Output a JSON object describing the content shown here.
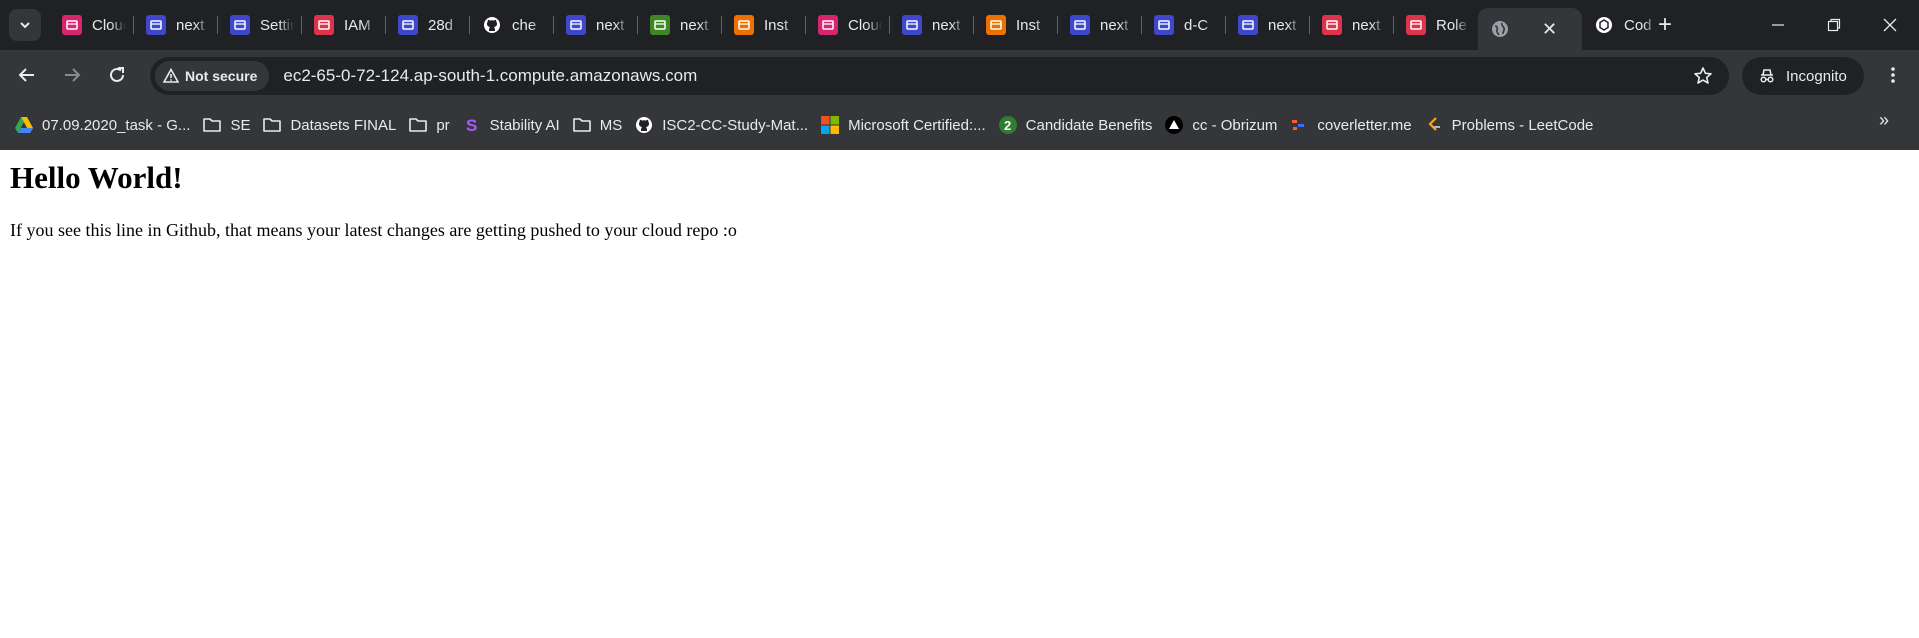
{
  "browser": {
    "tabs": [
      {
        "label": "Cloud",
        "icon": "aws-cloudshell-icon",
        "color": "#d6246e"
      },
      {
        "label": "next",
        "icon": "aws-s3-bucket-icon",
        "color": "#3f48cc"
      },
      {
        "label": "Settings",
        "icon": "aws-s3-bucket-icon",
        "color": "#3f48cc"
      },
      {
        "label": "IAM",
        "icon": "aws-iam-icon",
        "color": "#dd344c"
      },
      {
        "label": "28d",
        "icon": "aws-s3-bucket-icon",
        "color": "#3f48cc"
      },
      {
        "label": "che",
        "icon": "github-icon",
        "color": "#ffffff"
      },
      {
        "label": "next",
        "icon": "aws-service-icon",
        "color": "#3f48cc"
      },
      {
        "label": "next",
        "icon": "aws-codecommit-icon",
        "color": "#3f8624"
      },
      {
        "label": "Inst",
        "icon": "aws-ec2-icon",
        "color": "#ed7100"
      },
      {
        "label": "Cloud",
        "icon": "aws-cloudshell-icon",
        "color": "#d6246e"
      },
      {
        "label": "next",
        "icon": "aws-s3-bucket-icon",
        "color": "#3f48cc"
      },
      {
        "label": "Inst",
        "icon": "aws-ec2-icon",
        "color": "#ed7100"
      },
      {
        "label": "next",
        "icon": "aws-s3-bucket-icon",
        "color": "#3f48cc"
      },
      {
        "label": "d-C",
        "icon": "aws-service-icon",
        "color": "#3f48cc"
      },
      {
        "label": "next",
        "icon": "aws-service-icon",
        "color": "#3f48cc"
      },
      {
        "label": "next",
        "icon": "aws-iam-icon",
        "color": "#dd344c"
      },
      {
        "label": "Role",
        "icon": "aws-iam-icon",
        "color": "#dd344c"
      }
    ],
    "active_tab": {
      "icon": "globe-icon"
    },
    "last_tab": {
      "label": "Cod",
      "icon": "chatgpt-icon"
    },
    "new_tab_label": "+",
    "security_chip": "Not secure",
    "url": "ec2-65-0-72-124.ap-south-1.compute.amazonaws.com",
    "incognito_label": "Incognito",
    "bookmarks": [
      {
        "label": "07.09.2020_task - G...",
        "icon": "google-drive-icon"
      },
      {
        "label": "SE",
        "icon": "folder-icon"
      },
      {
        "label": "Datasets FINAL",
        "icon": "folder-icon"
      },
      {
        "label": "pr",
        "icon": "folder-icon"
      },
      {
        "label": "Stability AI",
        "icon": "stability-ai-icon"
      },
      {
        "label": "MS",
        "icon": "folder-icon"
      },
      {
        "label": "ISC2-CC-Study-Mat...",
        "icon": "github-icon"
      },
      {
        "label": "Microsoft Certified:...",
        "icon": "microsoft-icon"
      },
      {
        "label": "Candidate Benefits",
        "icon": "candidate-benefits-icon"
      },
      {
        "label": "cc - Obrizum",
        "icon": "obrizum-icon"
      },
      {
        "label": "coverletter.me",
        "icon": "coverletter-icon"
      },
      {
        "label": "Problems - LeetCode",
        "icon": "leetcode-icon"
      }
    ],
    "bookmarks_overflow": "»"
  },
  "page": {
    "heading": "Hello World!",
    "body_text": "If you see this line in Github, that means your latest changes are getting pushed to your cloud repo :o"
  }
}
